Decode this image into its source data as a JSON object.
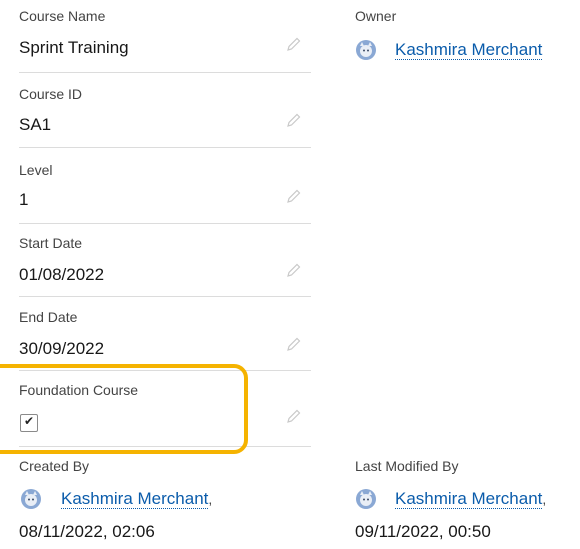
{
  "fields": {
    "course_name": {
      "label": "Course Name",
      "value": "Sprint Training"
    },
    "course_id": {
      "label": "Course ID",
      "value": "SA1"
    },
    "level": {
      "label": "Level",
      "value": "1"
    },
    "start_date": {
      "label": "Start Date",
      "value": "01/08/2022"
    },
    "end_date": {
      "label": "End Date",
      "value": "30/09/2022"
    },
    "foundation_course": {
      "label": "Foundation Course",
      "checked": true,
      "check_glyph": "✔"
    }
  },
  "owner": {
    "label": "Owner",
    "name": "Kashmira Merchant"
  },
  "created_by": {
    "label": "Created By",
    "name": "Kashmira Merchant",
    "separator": ",",
    "timestamp": "08/11/2022, 02:06"
  },
  "last_modified_by": {
    "label": "Last Modified By",
    "name": "Kashmira Merchant",
    "separator": ",",
    "timestamp": "09/11/2022, 00:50"
  },
  "icons": {
    "edit": "pencil-icon",
    "avatar": "user-avatar-icon"
  },
  "colors": {
    "link": "#0b5cab",
    "highlight": "#f5b300",
    "avatar_bg": "#8aa8d4"
  }
}
